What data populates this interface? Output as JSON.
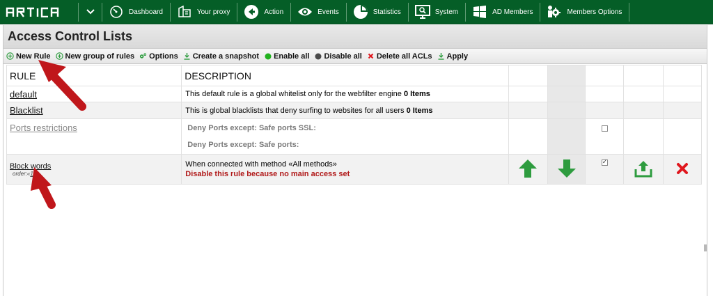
{
  "brand": {
    "logo_text": "ARTICA",
    "colors": {
      "nav_bg": "#055e27",
      "link": "#111111",
      "warn": "#b11a1a",
      "green_arrow": "#2e9c3f",
      "delete_red": "#e0171e"
    }
  },
  "nav": {
    "toggle_icon": "chevron-down-icon",
    "items": [
      {
        "label": "Dashboard",
        "icon": "speedometer-icon"
      },
      {
        "label": "Your proxy",
        "icon": "proxy-icon"
      },
      {
        "label": "Action",
        "icon": "back-arrow-circle-icon"
      },
      {
        "label": "Events",
        "icon": "eye-icon"
      },
      {
        "label": "Statistics",
        "icon": "pie-chart-icon"
      },
      {
        "label": "System",
        "icon": "monitor-search-icon"
      },
      {
        "label": "AD Members",
        "icon": "windows-icon"
      },
      {
        "label": "Members Options",
        "icon": "users-gear-icon"
      }
    ]
  },
  "page": {
    "title": "Access Control Lists"
  },
  "toolbar": {
    "new_rule": "New Rule",
    "new_group": "New group of rules",
    "options": "Options",
    "snapshot": "Create a snapshot",
    "enable_all": "Enable all",
    "disable_all": "Disable all",
    "delete_all": "Delete all ACLs",
    "apply": "Apply"
  },
  "table": {
    "headers": {
      "rule": "RULE",
      "description": "DESCRIPTION"
    },
    "rows": [
      {
        "name": "default",
        "desc_text": "This default rule is a global whitelist only for the webfilter engine",
        "desc_bold": "0 Items"
      },
      {
        "name": "Blacklist",
        "desc_text": "This is global blacklists that deny surfing to websites for all users",
        "desc_bold": "0 Items"
      },
      {
        "name": "Ports restrictions",
        "desc_line1": "Deny Ports except: Safe ports SSL:",
        "desc_line2": "Deny Ports except: Safe ports:",
        "enabled": false
      },
      {
        "name": "Block words",
        "order_label": "order:«",
        "order_value": "1",
        "desc_line1": "When connected with method «All methods»",
        "desc_line2": "Disable this rule because no main access set",
        "enabled": true
      }
    ]
  }
}
